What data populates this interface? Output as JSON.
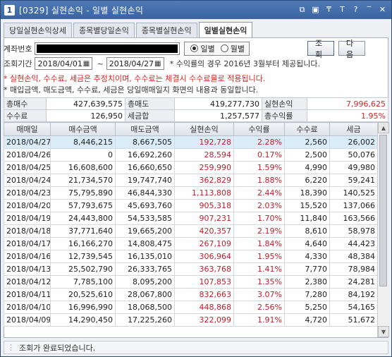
{
  "window": {
    "number": "1",
    "title": "[0329] 실현손익 - 일별 실현손익",
    "icons": [
      "restore-icon",
      "window-icon",
      "pin-icon",
      "text-size-icon",
      "help-icon",
      "minimize-icon",
      "close-icon"
    ],
    "icon_glyphs": [
      "⧉",
      "▣",
      "₸",
      "T",
      "?",
      "‾",
      "✕"
    ]
  },
  "tabs": [
    {
      "label": "당일실현손익상세",
      "active": false
    },
    {
      "label": "종목별당일손익",
      "active": false
    },
    {
      "label": "종목별실현손익",
      "active": false
    },
    {
      "label": "일별실현손익",
      "active": true
    }
  ],
  "controls": {
    "account_label": "계좌번호",
    "period_label": "조회기간",
    "date_from": "2018/04/01",
    "date_to": "2018/04/27",
    "tilde": "~",
    "radio_daily": "일별",
    "radio_monthly": "월별",
    "search_button": "조회",
    "next_button": "다음",
    "rate_note": "* 수익률의 경우 2016년 3월부터 제공됩니다."
  },
  "notes": {
    "red_note": "* 실현손익, 수수료, 세금은 추정치이며, 수수료는 체결시 수수료율로 적용됩니다.",
    "black_note": "* 매입금액, 매도금액, 수수료, 세금은 당일매매일지 화면의 내용과 동일합니다."
  },
  "summary": {
    "total_buy_label": "총매수",
    "total_buy": "427,639,575",
    "total_sell_label": "총매도",
    "total_sell": "419,277,730",
    "realized_label": "실현손익",
    "realized": "7,996,625",
    "fee_label": "수수료",
    "fee": "126,950",
    "tax_label": "세금합",
    "tax": "1,257,577",
    "total_rate_label": "총수익률",
    "total_rate": "1.95%"
  },
  "table": {
    "headers": [
      "매매일",
      "매수금액",
      "매도금액",
      "실현손익",
      "수익률",
      "수수료",
      "세금"
    ],
    "rows": [
      [
        "2018/04/27",
        "8,446,215",
        "8,667,505",
        "192,728",
        "2.28%",
        "2,560",
        "26,002"
      ],
      [
        "2018/04/26",
        "0",
        "16,692,260",
        "28,594",
        "0.17%",
        "2,500",
        "50,076"
      ],
      [
        "2018/04/25",
        "16,608,600",
        "16,660,650",
        "259,990",
        "1.59%",
        "4,990",
        "49,980"
      ],
      [
        "2018/04/24",
        "21,734,570",
        "19,747,740",
        "362,829",
        "1.88%",
        "6,220",
        "59,241"
      ],
      [
        "2018/04/23",
        "75,795,890",
        "46,844,330",
        "1,113,808",
        "2.44%",
        "18,390",
        "140,525"
      ],
      [
        "2018/04/20",
        "57,793,675",
        "45,693,760",
        "905,318",
        "2.03%",
        "15,520",
        "137,066"
      ],
      [
        "2018/04/19",
        "24,443,800",
        "54,533,585",
        "907,231",
        "1.70%",
        "11,840",
        "163,566"
      ],
      [
        "2018/04/18",
        "37,771,640",
        "19,665,200",
        "420,357",
        "2.19%",
        "8,610",
        "58,978"
      ],
      [
        "2018/04/17",
        "16,166,270",
        "14,808,475",
        "267,109",
        "1.84%",
        "4,640",
        "44,423"
      ],
      [
        "2018/04/16",
        "12,739,545",
        "16,135,010",
        "306,964",
        "1.95%",
        "4,330",
        "48,384"
      ],
      [
        "2018/04/13",
        "25,502,790",
        "26,333,765",
        "363,768",
        "1.41%",
        "7,770",
        "78,984"
      ],
      [
        "2018/04/12",
        "7,785,100",
        "8,095,200",
        "107,853",
        "1.35%",
        "2,380",
        "24,281"
      ],
      [
        "2018/04/11",
        "20,525,610",
        "28,067,800",
        "832,663",
        "3.07%",
        "7,280",
        "84,192"
      ],
      [
        "2018/04/10",
        "16,996,990",
        "18,068,500",
        "448,868",
        "2.56%",
        "5,250",
        "54,165"
      ],
      [
        "2018/04/09",
        "14,290,450",
        "17,225,260",
        "322,099",
        "1.91%",
        "4,720",
        "51,672"
      ]
    ]
  },
  "status": {
    "message": "조회가 완료되었습니다."
  },
  "colors": {
    "title_bar": "#3a64a0",
    "profit_red": "#c0202a",
    "selected_row": "#d9ecf8"
  }
}
